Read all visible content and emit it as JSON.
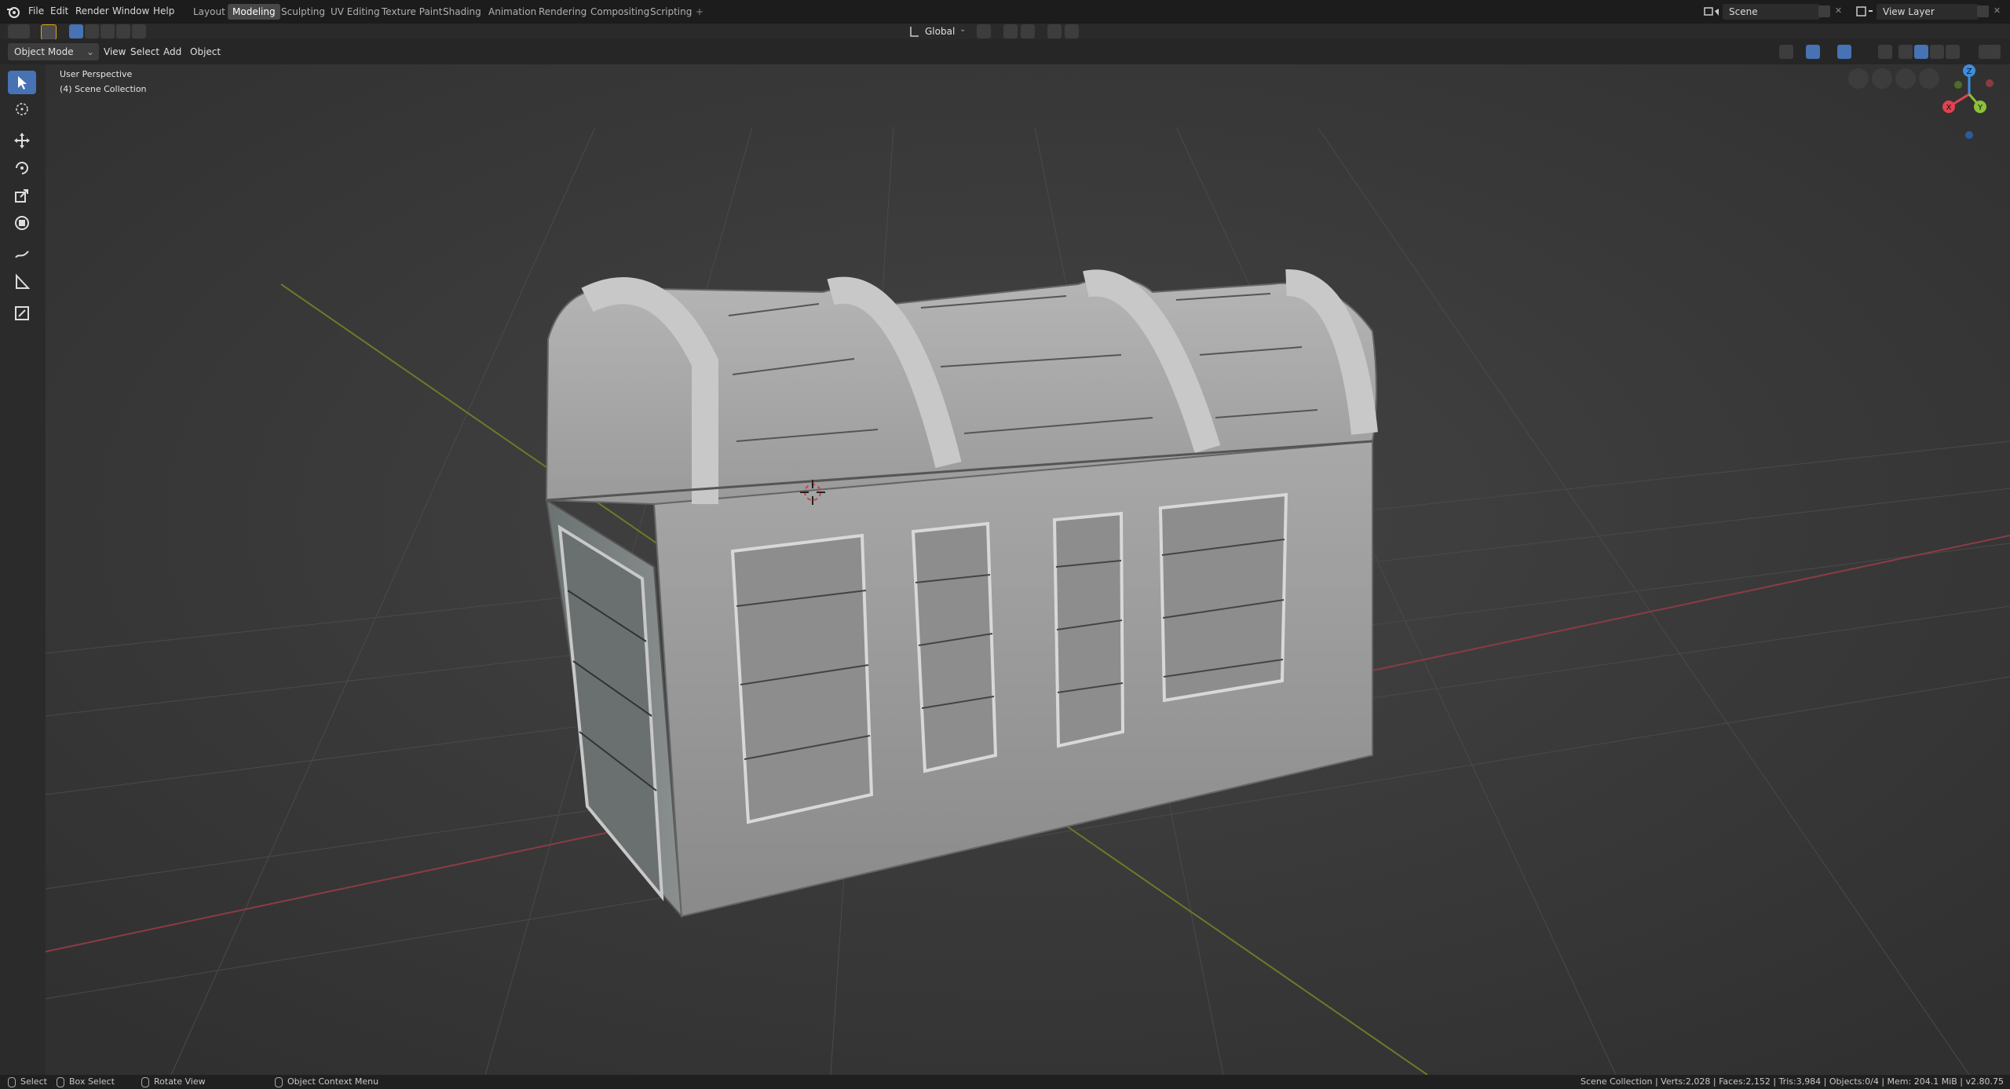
{
  "menus": [
    "File",
    "Edit",
    "Render",
    "Window",
    "Help"
  ],
  "workspaces": [
    "Layout",
    "Modeling",
    "Sculpting",
    "UV Editing",
    "Texture Paint",
    "Shading",
    "Animation",
    "Rendering",
    "Compositing",
    "Scripting"
  ],
  "active_workspace": "Modeling",
  "scene": {
    "name": "Scene",
    "view_layer": "View Layer"
  },
  "header": {
    "mode": "Object Mode",
    "menus": [
      "View",
      "Select",
      "Add",
      "Object"
    ],
    "orientation": "Global"
  },
  "viewport": {
    "title": "User Perspective",
    "collection": "(4) Scene Collection",
    "gizmo_axes": {
      "x": "X",
      "y": "Y",
      "z": "Z"
    }
  },
  "statusbar": {
    "select": "Select",
    "box_select": "Box Select",
    "rotate_view": "Rotate View",
    "context_menu": "Object Context Menu",
    "stats": "Scene Collection | Verts:2,028 | Faces:2,152 | Tris:3,984 | Objects:0/4 | Mem: 204.1 MiB | v2.80.75"
  },
  "colors": {
    "accent": "#4772b3",
    "x_axis": "#e04350",
    "y_axis": "#8cc23a",
    "z_axis": "#3d8ee0"
  }
}
